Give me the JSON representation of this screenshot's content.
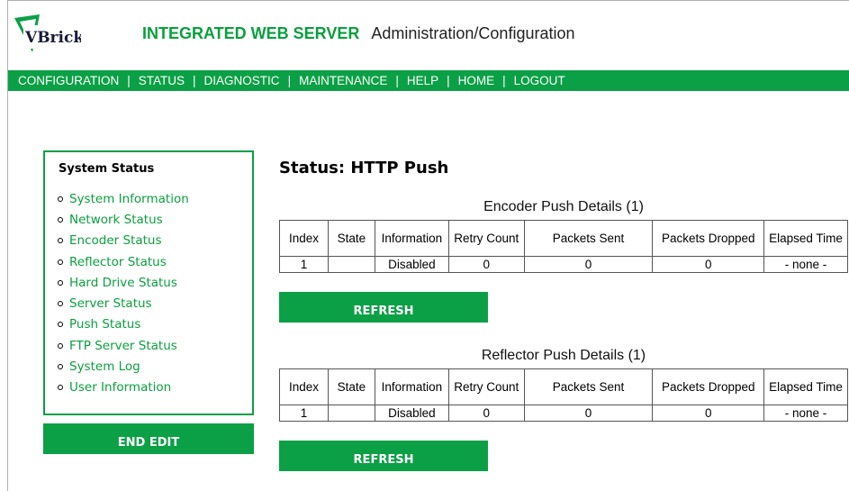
{
  "header": {
    "logo_text": "VBrick",
    "brand": "INTEGRATED WEB SERVER",
    "section": "Administration/Configuration"
  },
  "nav": {
    "items": [
      "CONFIGURATION",
      "STATUS",
      "DIAGNOSTIC",
      "MAINTENANCE",
      "HELP",
      "HOME",
      "LOGOUT"
    ],
    "separator": "|"
  },
  "sidebar": {
    "title": "System Status",
    "items": [
      "System Information",
      "Network Status",
      "Encoder Status",
      "Reflector Status",
      "Hard Drive Status",
      "Server Status",
      "Push Status",
      "FTP Server Status",
      "System Log",
      "User Information"
    ],
    "end_edit_label": "END EDIT"
  },
  "main": {
    "title": "Status: HTTP Push",
    "columns": [
      "Index",
      "State",
      "Information",
      "Retry Count",
      "Packets Sent",
      "Packets Dropped",
      "Elapsed Time"
    ],
    "encoder": {
      "caption": "Encoder Push Details  (1)",
      "rows": [
        [
          "1",
          "",
          "Disabled",
          "0",
          "0",
          "0",
          "- none -"
        ]
      ],
      "refresh_label": "REFRESH"
    },
    "reflector": {
      "caption": "Reflector Push Details  (1)",
      "rows": [
        [
          "1",
          "",
          "Disabled",
          "0",
          "0",
          "0",
          "- none -"
        ]
      ],
      "refresh_label": "REFRESH"
    }
  },
  "colors": {
    "accent": "#0ba046",
    "link": "#0a9f3e"
  }
}
